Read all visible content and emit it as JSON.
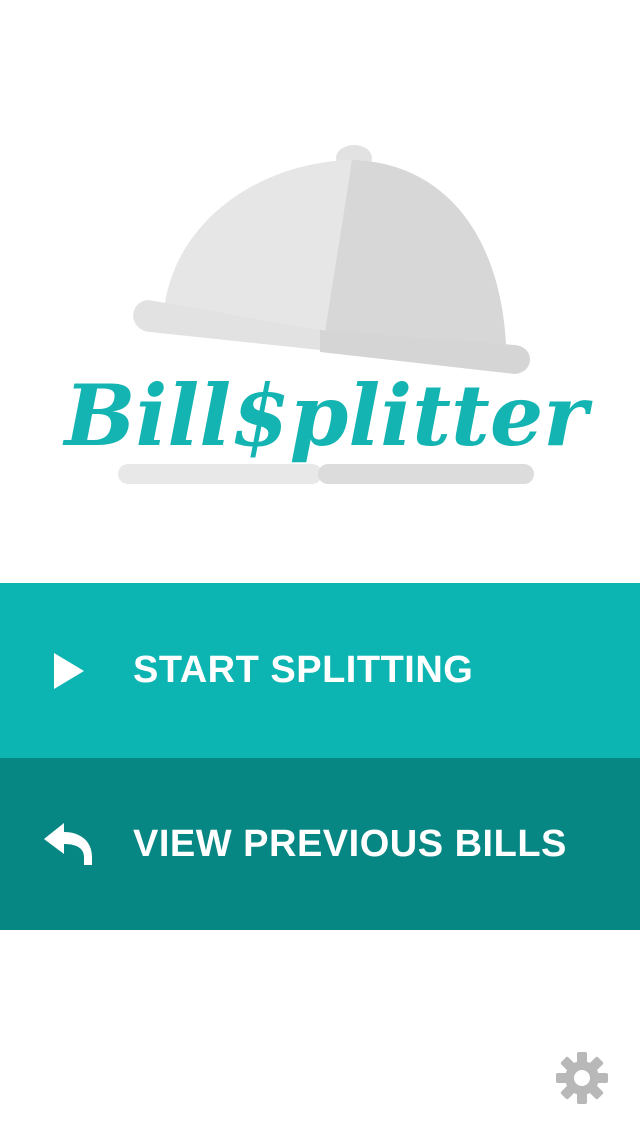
{
  "app": {
    "logo_text": "Bill$plitter"
  },
  "menu": {
    "start_label": "START SPLITTING",
    "view_label": "VIEW PREVIOUS BILLS"
  },
  "icons": {
    "start": "play-icon",
    "view": "reply-arrow-icon",
    "settings": "gear-icon"
  },
  "colors": {
    "brand_teal": "#0db5b2",
    "dark_teal": "#078783",
    "logo_text": "#13b4b1",
    "cloche_light": "#e6e6e6",
    "cloche_dark": "#d7d7d7",
    "gear": "#b8b8b8"
  }
}
